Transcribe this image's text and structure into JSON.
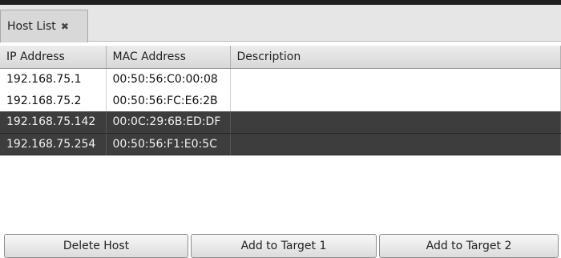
{
  "tab": {
    "label": "Host List",
    "close_icon": "close-icon"
  },
  "columns": [
    "IP Address",
    "MAC Address",
    "Description"
  ],
  "rows": [
    {
      "ip": "192.168.75.1",
      "mac": "00:50:56:C0:00:08",
      "description": "",
      "selected": false
    },
    {
      "ip": "192.168.75.2",
      "mac": "00:50:56:FC:E6:2B",
      "description": "",
      "selected": false
    },
    {
      "ip": "192.168.75.142",
      "mac": "00:0C:29:6B:ED:DF",
      "description": "",
      "selected": true
    },
    {
      "ip": "192.168.75.254",
      "mac": "00:50:56:F1:E0:5C",
      "description": "",
      "selected": true
    }
  ],
  "buttons": {
    "delete_host": "Delete Host",
    "add_target_1": "Add to Target 1",
    "add_target_2": "Add to Target 2"
  },
  "colors": {
    "selected_row": "#3d3d3d",
    "selected_text": "#f2f2f2"
  }
}
